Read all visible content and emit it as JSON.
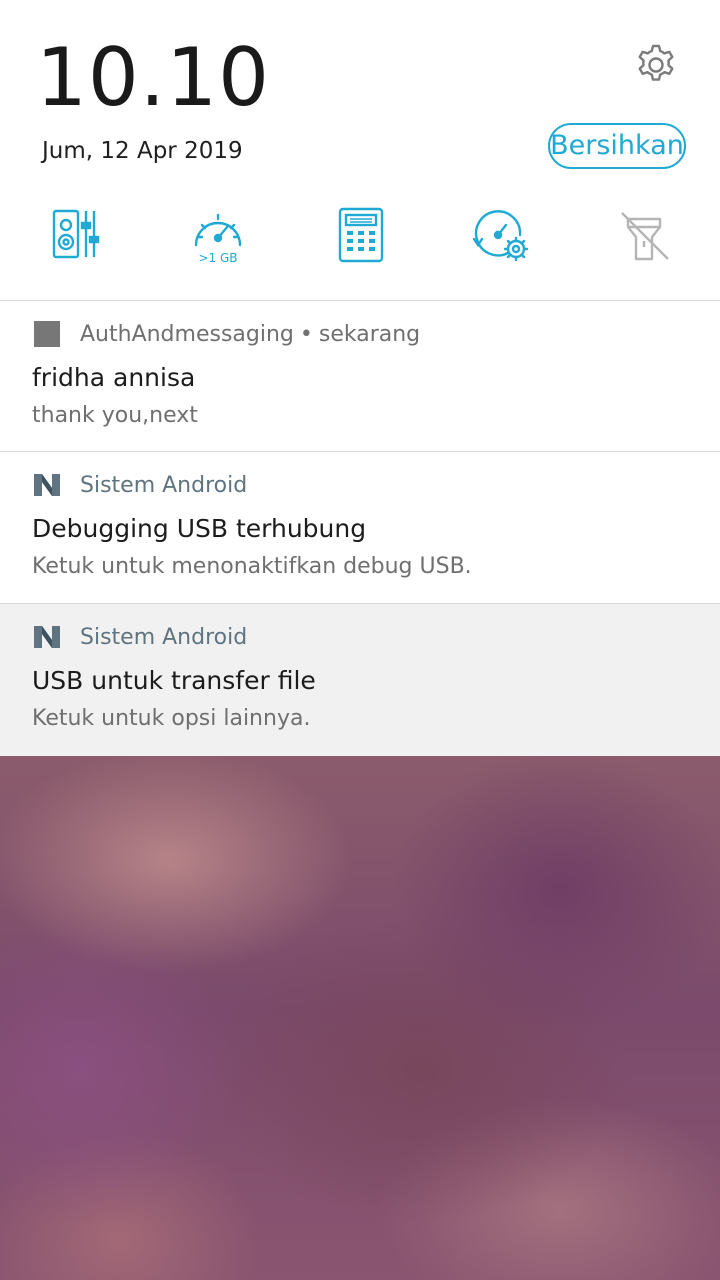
{
  "status": {
    "time": "10.10",
    "date": "Jum, 12 Apr 2019"
  },
  "actions": {
    "clear_label": "Bersihkan",
    "settings_icon": "gear-icon"
  },
  "quick_tiles": [
    {
      "name": "audio-wizard",
      "icon": "speaker-equalizer-icon"
    },
    {
      "name": "boost",
      "icon": "speedometer-icon",
      "label": ">1 GB"
    },
    {
      "name": "calculator",
      "icon": "calculator-icon"
    },
    {
      "name": "auto-start",
      "icon": "gauge-gear-icon"
    },
    {
      "name": "flashlight",
      "icon": "flashlight-off-icon"
    }
  ],
  "notifications": [
    {
      "app": "AuthAndmessaging",
      "time": "sekarang",
      "title": "fridha annisa",
      "text": "thank you,next"
    },
    {
      "app": "Sistem Android",
      "title": "Debugging USB terhubung",
      "text": "Ketuk untuk menonaktifkan debug USB."
    },
    {
      "app": "Sistem Android",
      "title": "USB untuk transfer file",
      "text": "Ketuk untuk opsi lainnya."
    }
  ],
  "colors": {
    "accent": "#1fa9d3",
    "app_label": "#5f7480"
  }
}
